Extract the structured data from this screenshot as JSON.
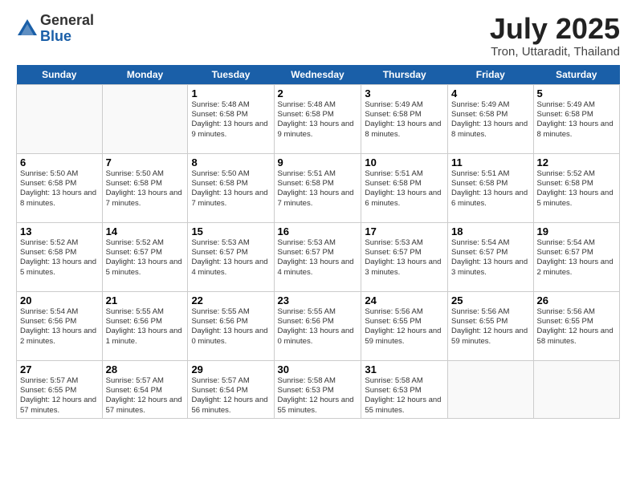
{
  "logo": {
    "general": "General",
    "blue": "Blue"
  },
  "title": "July 2025",
  "subtitle": "Tron, Uttaradit, Thailand",
  "headers": [
    "Sunday",
    "Monday",
    "Tuesday",
    "Wednesday",
    "Thursday",
    "Friday",
    "Saturday"
  ],
  "weeks": [
    [
      {
        "num": "",
        "info": ""
      },
      {
        "num": "",
        "info": ""
      },
      {
        "num": "1",
        "info": "Sunrise: 5:48 AM\nSunset: 6:58 PM\nDaylight: 13 hours and 9 minutes."
      },
      {
        "num": "2",
        "info": "Sunrise: 5:48 AM\nSunset: 6:58 PM\nDaylight: 13 hours and 9 minutes."
      },
      {
        "num": "3",
        "info": "Sunrise: 5:49 AM\nSunset: 6:58 PM\nDaylight: 13 hours and 8 minutes."
      },
      {
        "num": "4",
        "info": "Sunrise: 5:49 AM\nSunset: 6:58 PM\nDaylight: 13 hours and 8 minutes."
      },
      {
        "num": "5",
        "info": "Sunrise: 5:49 AM\nSunset: 6:58 PM\nDaylight: 13 hours and 8 minutes."
      }
    ],
    [
      {
        "num": "6",
        "info": "Sunrise: 5:50 AM\nSunset: 6:58 PM\nDaylight: 13 hours and 8 minutes."
      },
      {
        "num": "7",
        "info": "Sunrise: 5:50 AM\nSunset: 6:58 PM\nDaylight: 13 hours and 7 minutes."
      },
      {
        "num": "8",
        "info": "Sunrise: 5:50 AM\nSunset: 6:58 PM\nDaylight: 13 hours and 7 minutes."
      },
      {
        "num": "9",
        "info": "Sunrise: 5:51 AM\nSunset: 6:58 PM\nDaylight: 13 hours and 7 minutes."
      },
      {
        "num": "10",
        "info": "Sunrise: 5:51 AM\nSunset: 6:58 PM\nDaylight: 13 hours and 6 minutes."
      },
      {
        "num": "11",
        "info": "Sunrise: 5:51 AM\nSunset: 6:58 PM\nDaylight: 13 hours and 6 minutes."
      },
      {
        "num": "12",
        "info": "Sunrise: 5:52 AM\nSunset: 6:58 PM\nDaylight: 13 hours and 5 minutes."
      }
    ],
    [
      {
        "num": "13",
        "info": "Sunrise: 5:52 AM\nSunset: 6:58 PM\nDaylight: 13 hours and 5 minutes."
      },
      {
        "num": "14",
        "info": "Sunrise: 5:52 AM\nSunset: 6:57 PM\nDaylight: 13 hours and 5 minutes."
      },
      {
        "num": "15",
        "info": "Sunrise: 5:53 AM\nSunset: 6:57 PM\nDaylight: 13 hours and 4 minutes."
      },
      {
        "num": "16",
        "info": "Sunrise: 5:53 AM\nSunset: 6:57 PM\nDaylight: 13 hours and 4 minutes."
      },
      {
        "num": "17",
        "info": "Sunrise: 5:53 AM\nSunset: 6:57 PM\nDaylight: 13 hours and 3 minutes."
      },
      {
        "num": "18",
        "info": "Sunrise: 5:54 AM\nSunset: 6:57 PM\nDaylight: 13 hours and 3 minutes."
      },
      {
        "num": "19",
        "info": "Sunrise: 5:54 AM\nSunset: 6:57 PM\nDaylight: 13 hours and 2 minutes."
      }
    ],
    [
      {
        "num": "20",
        "info": "Sunrise: 5:54 AM\nSunset: 6:56 PM\nDaylight: 13 hours and 2 minutes."
      },
      {
        "num": "21",
        "info": "Sunrise: 5:55 AM\nSunset: 6:56 PM\nDaylight: 13 hours and 1 minute."
      },
      {
        "num": "22",
        "info": "Sunrise: 5:55 AM\nSunset: 6:56 PM\nDaylight: 13 hours and 0 minutes."
      },
      {
        "num": "23",
        "info": "Sunrise: 5:55 AM\nSunset: 6:56 PM\nDaylight: 13 hours and 0 minutes."
      },
      {
        "num": "24",
        "info": "Sunrise: 5:56 AM\nSunset: 6:55 PM\nDaylight: 12 hours and 59 minutes."
      },
      {
        "num": "25",
        "info": "Sunrise: 5:56 AM\nSunset: 6:55 PM\nDaylight: 12 hours and 59 minutes."
      },
      {
        "num": "26",
        "info": "Sunrise: 5:56 AM\nSunset: 6:55 PM\nDaylight: 12 hours and 58 minutes."
      }
    ],
    [
      {
        "num": "27",
        "info": "Sunrise: 5:57 AM\nSunset: 6:55 PM\nDaylight: 12 hours and 57 minutes."
      },
      {
        "num": "28",
        "info": "Sunrise: 5:57 AM\nSunset: 6:54 PM\nDaylight: 12 hours and 57 minutes."
      },
      {
        "num": "29",
        "info": "Sunrise: 5:57 AM\nSunset: 6:54 PM\nDaylight: 12 hours and 56 minutes."
      },
      {
        "num": "30",
        "info": "Sunrise: 5:58 AM\nSunset: 6:53 PM\nDaylight: 12 hours and 55 minutes."
      },
      {
        "num": "31",
        "info": "Sunrise: 5:58 AM\nSunset: 6:53 PM\nDaylight: 12 hours and 55 minutes."
      },
      {
        "num": "",
        "info": ""
      },
      {
        "num": "",
        "info": ""
      }
    ]
  ]
}
